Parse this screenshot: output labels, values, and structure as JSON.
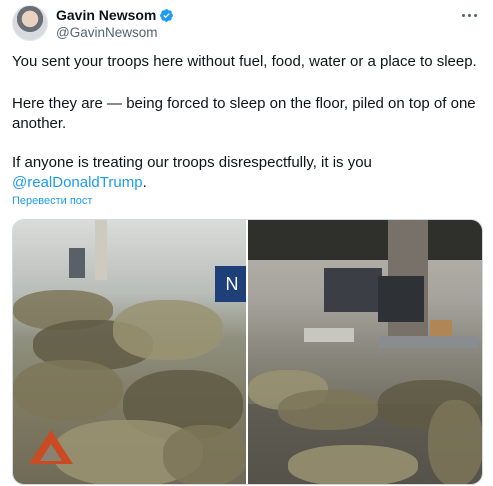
{
  "tweet": {
    "author_name": "Gavin Newsom",
    "author_handle": "@GavinNewsom",
    "paragraph_1": "You sent your troops here without fuel, food, water or a place to sleep.",
    "paragraph_2": "Here they are — being forced to sleep on the floor, piled on top of one another.",
    "paragraph_3_text": "If anyone is treating our troops disrespectfully, it is you ",
    "paragraph_3_mention": "@realDonaldTrump",
    "paragraph_3_end": ".",
    "translate_label": "Перевести пост"
  },
  "icons": {
    "verified": "verified-badge-icon",
    "more": "more-options-icon"
  },
  "colors": {
    "link": "#1d9bf0",
    "secondary_text": "#536471",
    "primary_text": "#0f1419"
  },
  "media": {
    "photo_count": 2,
    "left_photo_sign": "N"
  }
}
